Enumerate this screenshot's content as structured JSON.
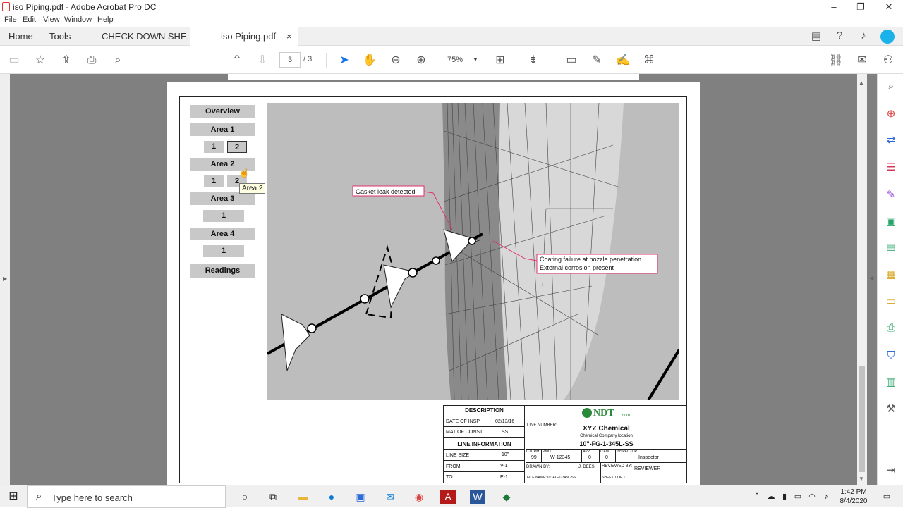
{
  "window": {
    "title": "iso Piping.pdf - Adobe Acrobat Pro DC"
  },
  "menu": [
    "File",
    "Edit",
    "View",
    "Window",
    "Help"
  ],
  "tabs": {
    "home": "Home",
    "tools": "Tools",
    "doc1": "CHECK DOWN SHE...",
    "doc2": "iso Piping.pdf",
    "close": "×"
  },
  "toolbar": {
    "page_current": "3",
    "page_total": "/ 3",
    "zoom": "75%"
  },
  "nav": {
    "overview": "Overview",
    "area1": "Area 1",
    "a1b1": "1",
    "a1b2": "2",
    "area2": "Area 2",
    "a2b1": "1",
    "a2b2": "2",
    "area3": "Area 3",
    "a3b1": "1",
    "area4": "Area 4",
    "a4b1": "1",
    "readings": "Readings",
    "tooltip": "Area 2"
  },
  "annotations": {
    "gasket": "Gasket leak detected",
    "coating1": "Coating failure at nozzle penetration",
    "coating2": "External corrosion present"
  },
  "titleblock": {
    "description": "DESCRIPTION",
    "date_label": "DATE OF INSP",
    "date_val": "02/13/16",
    "mat_label": "MAT OF CONST",
    "mat_val": "SS",
    "line_info": "LINE INFORMATION",
    "size_label": "LINE SIZE",
    "size_val": "10\"",
    "from_label": "FROM",
    "from_val": "V-1",
    "to_label": "TO",
    "to_val": "E-1",
    "logo": "NDT",
    "logo_sub": ".com",
    "line_number": "LINE NUMBER:",
    "company": "XYZ Chemical",
    "company_loc": "Chemical Company location",
    "line_id": "10\"-FG-1-345L-SS",
    "ctl_label": "CTL RM",
    "ctl_val": "99",
    "pid_label": "P&ID",
    "pid_val": "W-12345",
    "app_label": "APP",
    "app_val": "0",
    "item_label": "ITEM",
    "item_val": "0",
    "inspector_label": "INSPECTOR",
    "inspector_val": "Inspector",
    "drawn_label": "DRAWN BY:",
    "drawn_val": "J. DEES",
    "reviewed_label": "REVIEWED BY:",
    "reviewed_val": "REVIEWER",
    "file_name": "FILE NAME:10\"-FG-1-345L-SS",
    "sheet": "SHEET 1 OF 1"
  },
  "taskbar": {
    "search_placeholder": "Type here to search",
    "time": "1:42 PM",
    "date": "8/4/2020"
  },
  "colors": {
    "accent": "#1473e6",
    "annotation": "#e0306a",
    "doc_bg": "#808080"
  }
}
